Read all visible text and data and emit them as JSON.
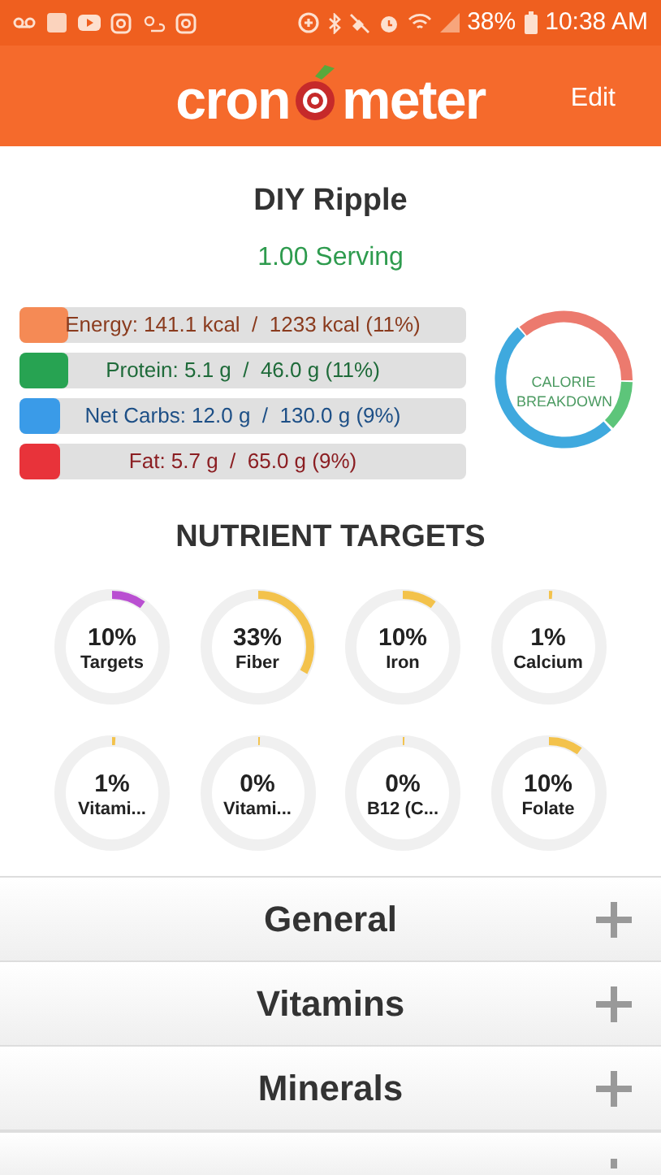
{
  "status_bar": {
    "battery": "38%",
    "time": "10:38 AM"
  },
  "header": {
    "logo": {
      "left": "cron",
      "right": "meter"
    },
    "action": "Edit"
  },
  "food": {
    "title": "DIY Ripple",
    "serving": "1.00 Serving"
  },
  "macros": [
    {
      "label": "Energy: 141.1 kcal  /  1233 kcal (11%)",
      "level": 0.11,
      "color": "#f58a55"
    },
    {
      "label": "Protein: 5.1 g  /  46.0 g (11%)",
      "level": 0.11,
      "color": "#27a352"
    },
    {
      "label": "Net Carbs: 12.0 g  /  130.0 g (9%)",
      "level": 0.09,
      "color": "#3a9be8"
    },
    {
      "label": "Fat: 5.7 g  /  65.0 g (9%)",
      "level": 0.09,
      "color": "#e8333a"
    }
  ],
  "calorie_breakdown": {
    "label": "CALORIE BREAKDOWN"
  },
  "nutrient_targets": {
    "title": "NUTRIENT TARGETS",
    "items": [
      {
        "percent": "10%",
        "name": "Targets",
        "level": 0.1,
        "color": "#b94fd1"
      },
      {
        "percent": "33%",
        "name": "Fiber",
        "level": 0.33,
        "color": "#f3c24b"
      },
      {
        "percent": "10%",
        "name": "Iron",
        "level": 0.1,
        "color": "#f3c24b"
      },
      {
        "percent": "1%",
        "name": "Calcium",
        "level": 0.01,
        "color": "#f3c24b"
      },
      {
        "percent": "1%",
        "name": "Vitami...",
        "level": 0.01,
        "color": "#f3c24b"
      },
      {
        "percent": "0%",
        "name": "Vitami...",
        "level": 0.0,
        "color": "#f3c24b"
      },
      {
        "percent": "0%",
        "name": "B12 (C...",
        "level": 0.0,
        "color": "#f3c24b"
      },
      {
        "percent": "10%",
        "name": "Folate",
        "level": 0.1,
        "color": "#f3c24b"
      }
    ]
  },
  "sections": [
    {
      "title": "General",
      "expanded": false
    },
    {
      "title": "Vitamins",
      "expanded": false
    },
    {
      "title": "Minerals",
      "expanded": false
    }
  ]
}
